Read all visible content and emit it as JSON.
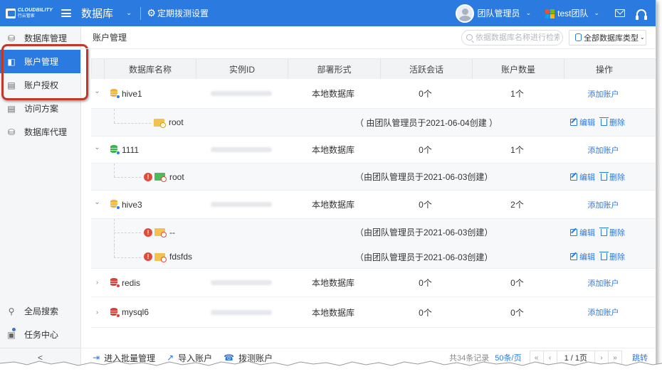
{
  "header": {
    "logo_text": "CLOUDBILITY",
    "logo_sub": "行云管家",
    "app_title": "数据库",
    "schedule_label": "定期拨测设置",
    "user_name": "团队管理员",
    "team_name": "test团队",
    "brand_color": "#2b7ae0"
  },
  "sidebar": {
    "items": [
      {
        "label": "数据库管理",
        "icon": "database-icon",
        "active": false
      },
      {
        "label": "账户管理",
        "icon": "id-card-icon",
        "active": true
      },
      {
        "label": "账户授权",
        "icon": "authorize-doc-icon",
        "active": false
      },
      {
        "label": "访问方案",
        "icon": "clipboard-icon",
        "active": false
      },
      {
        "label": "数据库代理",
        "icon": "db-proxy-icon",
        "active": false
      }
    ],
    "bottom": [
      {
        "label": "全局搜索",
        "icon": "search-icon"
      },
      {
        "label": "任务中心",
        "icon": "task-icon"
      }
    ],
    "collapse_label": "<"
  },
  "main": {
    "page_title": "账户管理",
    "search_placeholder": "依据数据库名称进行检索",
    "type_filter": "全部数据库类型"
  },
  "table": {
    "columns": [
      "数据库名称",
      "实例ID",
      "部署形式",
      "活跃会话",
      "账户数量",
      "操作"
    ],
    "add_account_label": "添加账户",
    "edit_label": "编辑",
    "delete_label": "删除",
    "databases": [
      {
        "name": "hive1",
        "deploy": "本地数据库",
        "sessions": "0个",
        "accounts": "1个",
        "icon_color": "#f2b233",
        "sub_color": "#2b7ae0",
        "expanded": true,
        "children": [
          {
            "name": "root",
            "warn": false,
            "note": "（ 由团队管理员于2021-06-04创建 ）"
          }
        ]
      },
      {
        "name": "1111",
        "deploy": "本地数据库",
        "sessions": "0个",
        "accounts": "1个",
        "icon_color": "#3bb34a",
        "sub_color": "#2b7ae0",
        "expanded": true,
        "children": [
          {
            "name": "root",
            "warn": true,
            "note": "（由团队管理员于2021-06-03创建）"
          }
        ]
      },
      {
        "name": "hive3",
        "deploy": "本地数据库",
        "sessions": "0个",
        "accounts": "2个",
        "icon_color": "#f2b233",
        "sub_color": "#2b7ae0",
        "expanded": true,
        "children": [
          {
            "name": "--",
            "warn": true,
            "note": "（由团队管理员于2021-06-03创建）"
          },
          {
            "name": "fdsfds",
            "warn": true,
            "note": "（由团队管理员于2021-06-03创建）"
          }
        ]
      },
      {
        "name": "redis",
        "deploy": "本地数据库",
        "sessions": "0个",
        "accounts": "0个",
        "icon_color": "#d9423a",
        "sub_color": "#d9423a",
        "expanded": false,
        "children": []
      },
      {
        "name": "mysql6",
        "deploy": "本地数据库",
        "sessions": "0个",
        "accounts": "0个",
        "icon_color": "#d9423a",
        "sub_color": "#d9423a",
        "expanded": false,
        "children": []
      }
    ]
  },
  "footer": {
    "actions": [
      {
        "label": "进入批量管理",
        "icon": "batch-enter-icon"
      },
      {
        "label": "导入账户",
        "icon": "import-icon"
      },
      {
        "label": "拨测账户",
        "icon": "probe-icon"
      }
    ],
    "total": "共34条记录",
    "page_size": "50条/页",
    "page_indicator": "1 / 1页",
    "jump_label": "跳转"
  }
}
